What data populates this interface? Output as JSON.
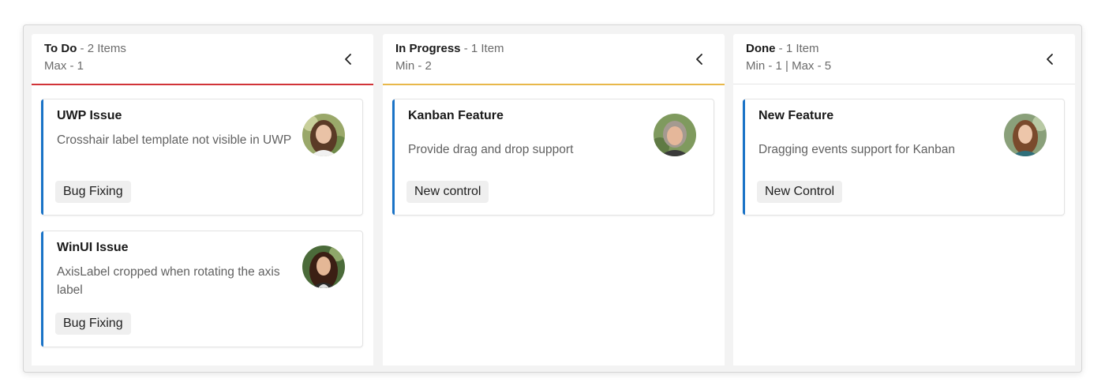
{
  "columns": [
    {
      "title": "To Do",
      "count_text": " - 2 Items",
      "limits": "Max - 1",
      "underline_color": "#d13438",
      "cards": [
        {
          "title": "UWP Issue",
          "description": "Crosshair label template not visible in UWP",
          "tag": "Bug Fixing",
          "avatar": "avatar-woman-1"
        },
        {
          "title": "WinUI Issue",
          "description": "AxisLabel cropped when rotating the axis label",
          "tag": "Bug Fixing",
          "avatar": "avatar-woman-2"
        }
      ]
    },
    {
      "title": "In Progress",
      "count_text": " - 1 Item",
      "limits": "Min - 2",
      "underline_color": "#e8b84a",
      "cards": [
        {
          "title": "Kanban Feature",
          "description": "Provide drag and drop support",
          "tag": "New control",
          "avatar": "avatar-woman-3"
        }
      ]
    },
    {
      "title": "Done",
      "count_text": " - 1 Item",
      "limits": "Min - 1 | Max - 5",
      "underline_color": "#e6e6e6",
      "cards": [
        {
          "title": "New Feature",
          "description": "Dragging events support for Kanban",
          "tag": "New Control",
          "avatar": "avatar-woman-4"
        }
      ]
    }
  ],
  "card_accent_color": "#1a73c7",
  "icons": {
    "collapse": "chevron-left-icon"
  }
}
